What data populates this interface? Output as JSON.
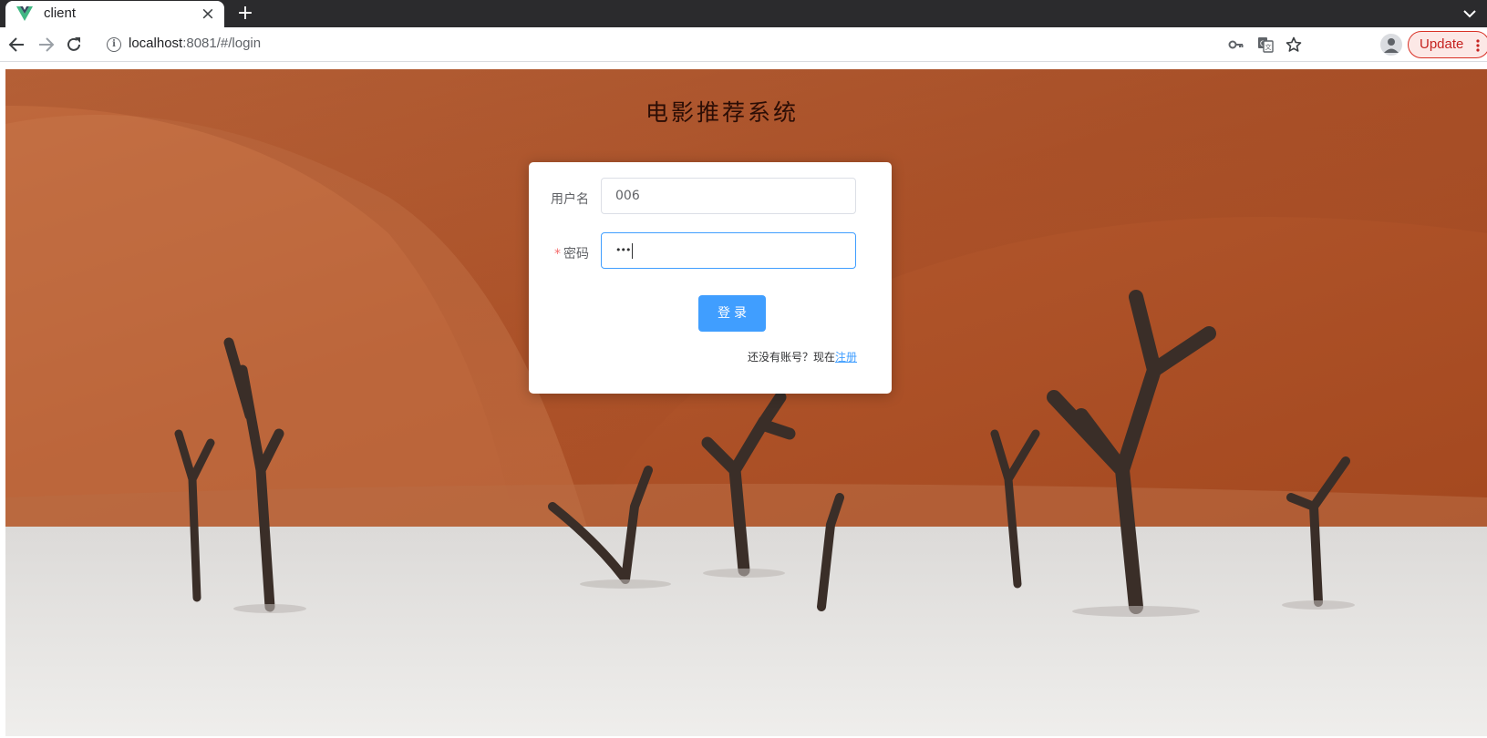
{
  "browser": {
    "tab_title": "client",
    "tab_close_symbol": "×",
    "new_tab_symbol": "+",
    "url_host": "localhost",
    "url_rest": ":8081/#/login",
    "update_label": "Update",
    "icons": [
      "vue-favicon-icon",
      "back-icon",
      "forward-icon",
      "reload-icon",
      "site-info-icon",
      "key-icon",
      "translate-icon",
      "star-icon",
      "profile-icon",
      "more-icon",
      "tab-list-icon"
    ]
  },
  "page": {
    "title": "电影推荐系统",
    "form": {
      "username_label": "用户名",
      "username_value": "006",
      "password_required_mark": "*",
      "password_label": "密码",
      "password_mask": "•••",
      "submit_label": "登录",
      "register_prompt": "还没有账号？现在",
      "register_link": "注册"
    }
  },
  "colors": {
    "primary": "#409eff",
    "required": "#f56c6c",
    "update_red": "#d93025"
  }
}
